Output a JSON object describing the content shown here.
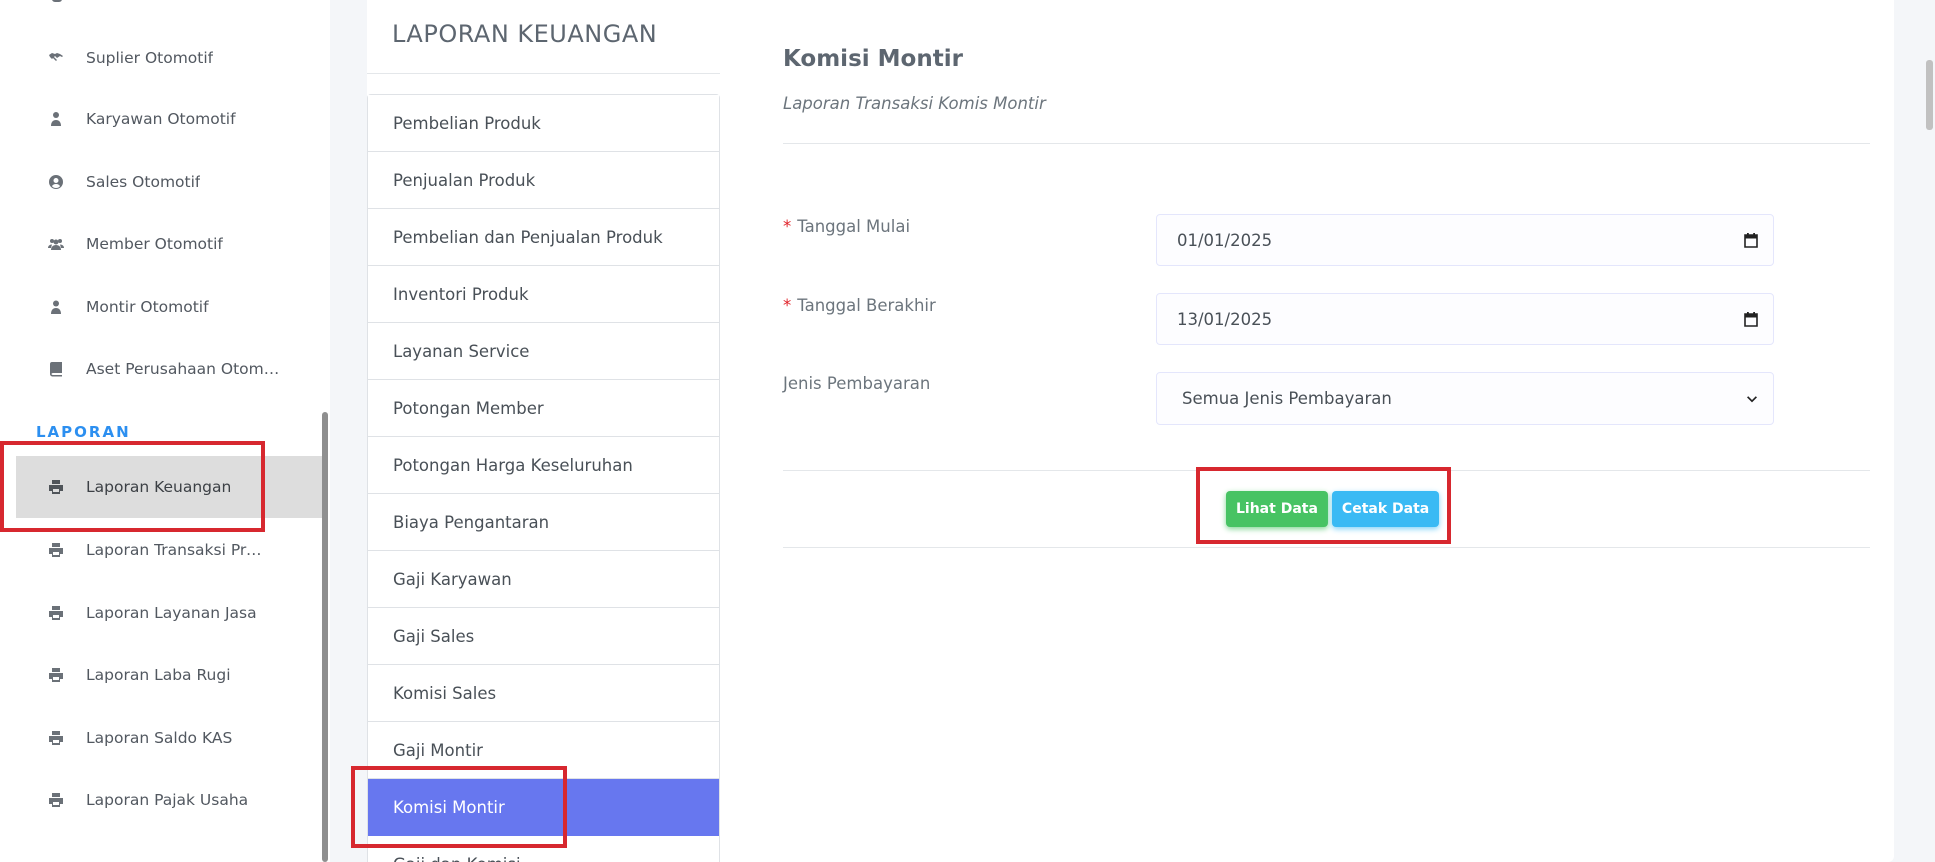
{
  "sidebar": {
    "items_top": [
      {
        "label": "Suplier Otomotif",
        "icon": "handshake-icon"
      },
      {
        "label": "Karyawan Otomotif",
        "icon": "user-tie-icon"
      },
      {
        "label": "Sales Otomotif",
        "icon": "user-circle-icon"
      },
      {
        "label": "Member Otomotif",
        "icon": "users-icon"
      },
      {
        "label": "Montir Otomotif",
        "icon": "user-icon"
      },
      {
        "label": "Aset Perusahaan Otomotif",
        "icon": "book-icon"
      }
    ],
    "section_label": "LAPORAN",
    "items_laporan": [
      {
        "label": "Laporan Keuangan",
        "icon": "print-icon",
        "active": true
      },
      {
        "label": "Laporan Transaksi Produk",
        "icon": "print-icon"
      },
      {
        "label": "Laporan Layanan Jasa",
        "icon": "print-icon"
      },
      {
        "label": "Laporan Laba Rugi",
        "icon": "print-icon"
      },
      {
        "label": "Laporan Saldo KAS",
        "icon": "print-icon"
      },
      {
        "label": "Laporan Pajak Usaha",
        "icon": "print-icon"
      }
    ]
  },
  "report_menu": {
    "title": "LAPORAN KEUANGAN",
    "items": [
      {
        "label": "Pembelian Produk"
      },
      {
        "label": "Penjualan Produk"
      },
      {
        "label": "Pembelian dan Penjualan Produk"
      },
      {
        "label": "Inventori Produk"
      },
      {
        "label": "Layanan Service"
      },
      {
        "label": "Potongan Member"
      },
      {
        "label": "Potongan Harga Keseluruhan"
      },
      {
        "label": "Biaya Pengantaran"
      },
      {
        "label": "Gaji Karyawan"
      },
      {
        "label": "Gaji Sales"
      },
      {
        "label": "Komisi Sales"
      },
      {
        "label": "Gaji Montir"
      },
      {
        "label": "Komisi Montir",
        "active": true
      },
      {
        "label": "Gaji dan Komisi"
      }
    ]
  },
  "content": {
    "title": "Komisi Montir",
    "subtitle": "Laporan Transaksi Komis Montir",
    "form": {
      "start_date": {
        "label": "Tanggal Mulai",
        "required": true,
        "value": "01/01/2025"
      },
      "end_date": {
        "label": "Tanggal Berakhir",
        "required": true,
        "value": "13/01/2025"
      },
      "payment_type": {
        "label": "Jenis Pembayaran",
        "value": "Semua Jenis Pembayaran"
      }
    },
    "buttons": {
      "view": "Lihat Data",
      "print": "Cetak Data"
    }
  },
  "colors": {
    "accent": "#6777ef",
    "success": "#47c363",
    "info": "#3abaf4",
    "section": "#2c8ff0",
    "annotation": "#d7282f"
  }
}
